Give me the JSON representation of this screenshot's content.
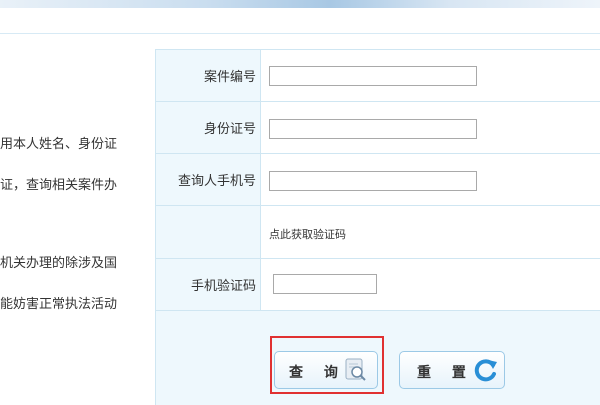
{
  "left_panel": {
    "lines": [
      "用本人姓名、身份证",
      "证，查询相关案件办",
      "机关办理的除涉及国",
      "能妨害正常执法活动"
    ]
  },
  "form": {
    "case_number_label": "案件编号",
    "case_number_value": "",
    "id_number_label": "身份证号",
    "id_number_value": "",
    "phone_label": "查询人手机号",
    "phone_value": "",
    "get_code_link": "点此获取验证码",
    "sms_code_label": "手机验证码",
    "sms_code_value": ""
  },
  "buttons": {
    "query_label": "查 询",
    "reset_label": "重 置"
  },
  "icons": {
    "query_icon": "magnifier-document-icon",
    "reset_icon": "refresh-arrow-icon"
  },
  "colors": {
    "label_bg": "#eef8fd",
    "border": "#cfe6f2",
    "highlight": "#e03131"
  }
}
